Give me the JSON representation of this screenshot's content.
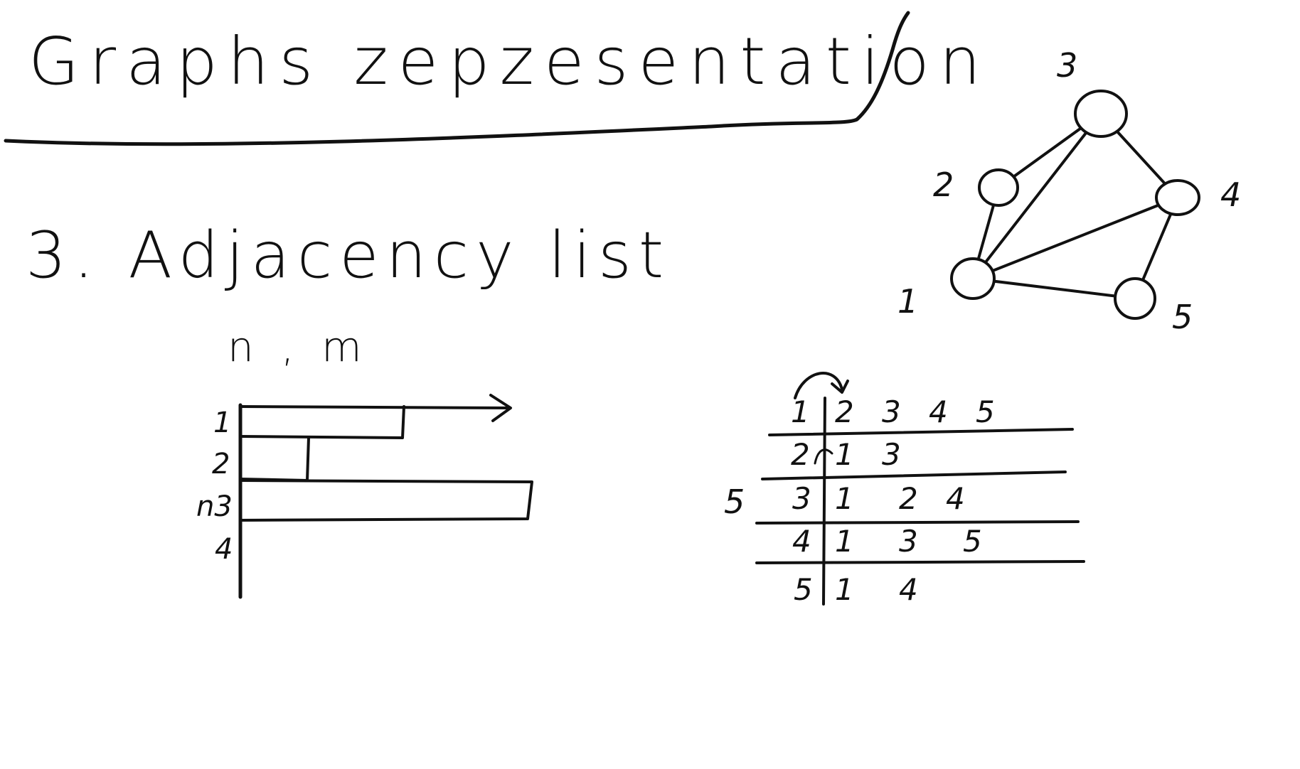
{
  "title": "Graphs zepzesentation",
  "section": "3. Adjacency list",
  "params": "n , m",
  "array_sketch": {
    "row_labels": [
      "1",
      "2",
      "n3",
      "4"
    ]
  },
  "graph": {
    "nodes": [
      {
        "id": "1",
        "label": "1"
      },
      {
        "id": "2",
        "label": "2"
      },
      {
        "id": "3",
        "label": "3"
      },
      {
        "id": "4",
        "label": "4"
      },
      {
        "id": "5",
        "label": "5"
      }
    ],
    "edges": [
      [
        "1",
        "2"
      ],
      [
        "1",
        "3"
      ],
      [
        "1",
        "4"
      ],
      [
        "1",
        "5"
      ],
      [
        "2",
        "3"
      ],
      [
        "3",
        "4"
      ],
      [
        "4",
        "5"
      ]
    ]
  },
  "adjacency_table": {
    "side_label": "5",
    "rows": [
      {
        "vertex": "1",
        "neighbors": [
          "2",
          "3",
          "4",
          "5"
        ]
      },
      {
        "vertex": "2",
        "neighbors": [
          "1",
          "3"
        ]
      },
      {
        "vertex": "3",
        "neighbors": [
          "1",
          "2",
          "4"
        ]
      },
      {
        "vertex": "4",
        "neighbors": [
          "1",
          "3",
          "5"
        ]
      },
      {
        "vertex": "5",
        "neighbors": [
          "1",
          "4"
        ]
      }
    ]
  },
  "colors": {
    "ink": "#111111",
    "background": "#ffffff"
  }
}
